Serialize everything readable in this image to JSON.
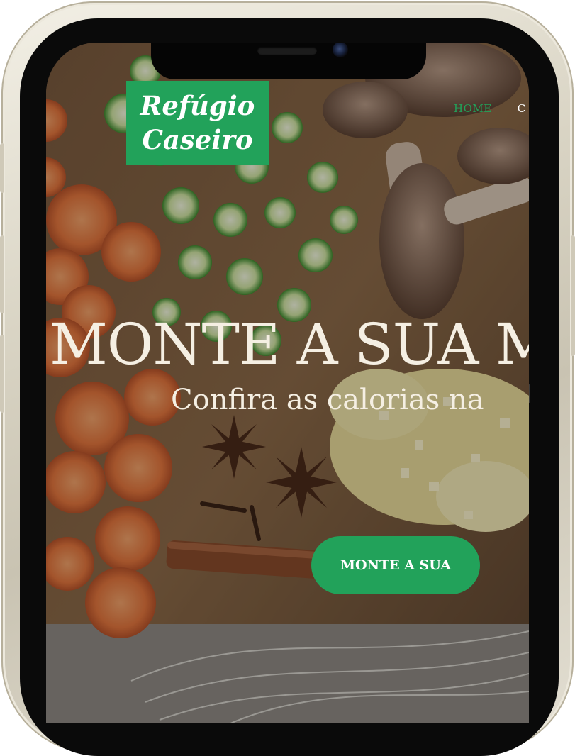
{
  "brand": {
    "line1": "Refúgio",
    "line2": "Caseiro",
    "color": "#22a25a"
  },
  "nav": {
    "items": [
      {
        "label": "HOME",
        "active": true
      },
      {
        "label": "C",
        "active": false
      }
    ]
  },
  "hero": {
    "title": "MONTE A SUA M",
    "subtitle": "Confira as calorias na",
    "cta_label": "MONTE A SUA"
  },
  "colors": {
    "accent": "#22a25a",
    "hero_text": "#f5efe3",
    "frame": "#d9d4c4"
  }
}
